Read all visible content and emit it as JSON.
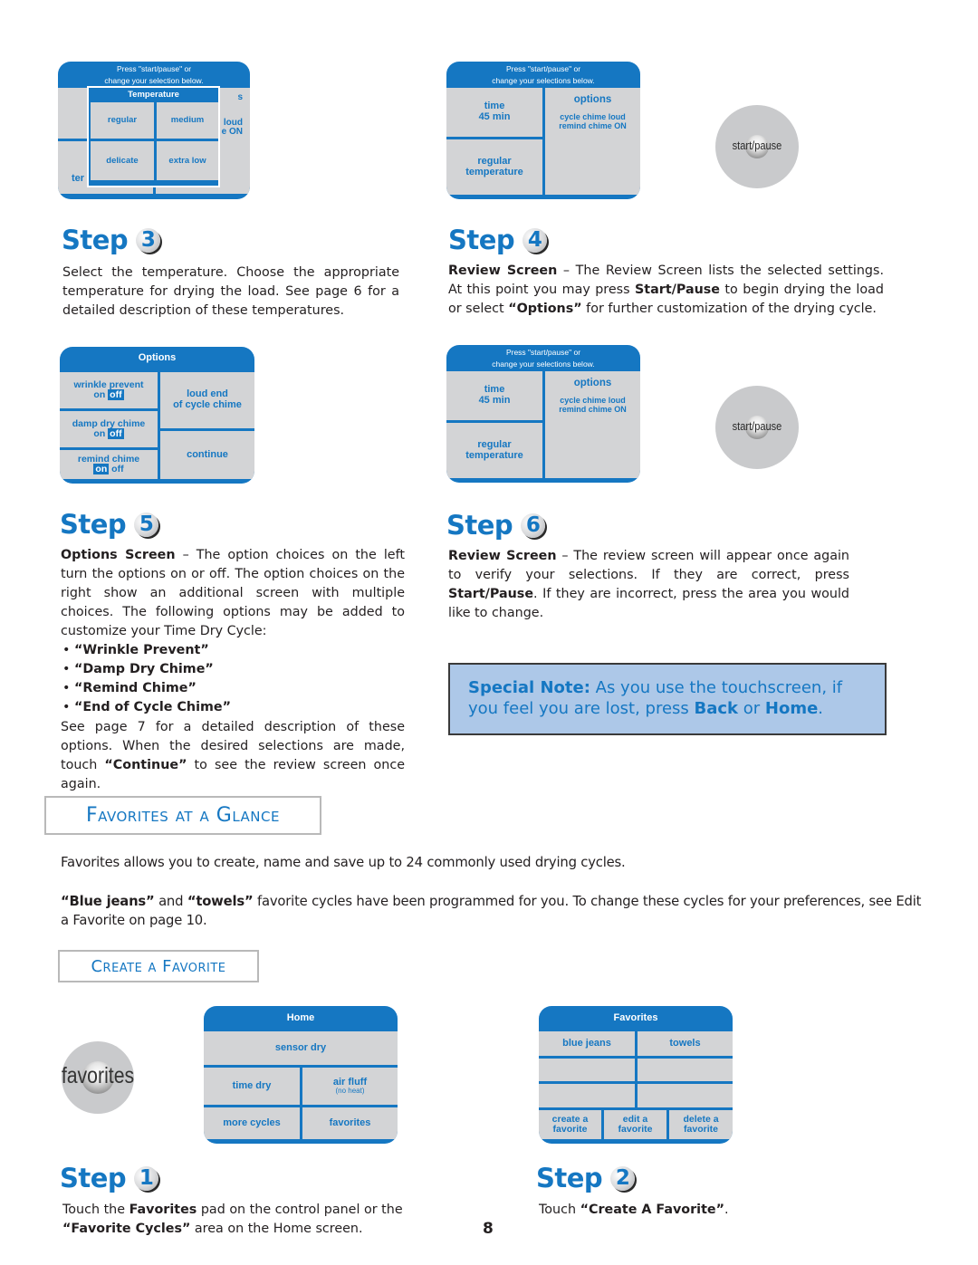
{
  "screens": {
    "temperature_overlay": {
      "prompt_line1": "Press \"start/pause\" or",
      "prompt_line2": "change your selection below.",
      "title": "Temperature",
      "options": [
        "regular",
        "medium",
        "delicate",
        "extra low"
      ],
      "peek_right_1": "s",
      "peek_right_2": "loud",
      "peek_right_3": "e ON",
      "peek_left": "ter"
    },
    "review": {
      "prompt_line1": "Press \"start/pause\" or",
      "prompt_line2": "change your selections below.",
      "time_label": "time",
      "time_value": "45 min",
      "temp_line1": "regular",
      "temp_line2": "temperature",
      "options_label": "options",
      "options_line1": "cycle chime loud",
      "options_line2": "remind chime ON"
    },
    "options": {
      "title": "Options",
      "wrinkle_label": "wrinkle prevent",
      "damp_label": "damp dry chime",
      "remind_label": "remind chime",
      "on": "on",
      "off": "off",
      "wrinkle_selected": "off",
      "damp_selected": "off",
      "remind_selected": "on",
      "loud_end_line1": "loud end",
      "loud_end_line2": "of cycle chime",
      "continue": "continue"
    },
    "home": {
      "title": "Home",
      "sensor_dry": "sensor dry",
      "time_dry": "time dry",
      "air_fluff": "air fluff",
      "air_fluff_note": "(no heat)",
      "more_cycles": "more cycles",
      "favorites": "favorites"
    },
    "favorites": {
      "title": "Favorites",
      "items": [
        "blue jeans",
        "towels",
        "",
        "",
        "",
        ""
      ],
      "create_line1": "create a",
      "create_line2": "favorite",
      "edit_line1": "edit a",
      "edit_line2": "favorite",
      "delete_line1": "delete a",
      "delete_line2": "favorite"
    }
  },
  "pads": {
    "start_pause": "start/pause",
    "favorites": "favorites"
  },
  "steps": {
    "step3": {
      "word": "Step",
      "num": "3",
      "text": "Select the temperature.  Choose the appropriate temperature for drying the load.  See page 6 for a detailed description of these temperatures."
    },
    "step4": {
      "word": "Step",
      "num": "4",
      "lead": "Review Screen",
      "t1": " – The Review Screen lists the selected settings. At this point you may press ",
      "b1": "Start/Pause",
      "t2": " to begin drying the load or select ",
      "b2": "“Options”",
      "t3": " for further customization of the drying cycle."
    },
    "step5": {
      "word": "Step",
      "num": "5",
      "lead": "Options Screen",
      "t1": " – The option choices on the left turn the options on or off. The option choices on the right show an additional screen with multiple choices. The following options may be added to customize your Time Dry Cycle:",
      "bullets": [
        "“Wrinkle Prevent”",
        "“Damp Dry Chime”",
        "“Remind Chime”",
        "“End of Cycle Chime”"
      ],
      "after1": "See page 7 for a detailed description of these options. When the desired selections are made, touch ",
      "after_bold": "“Continue”",
      "after2": " to see the review screen once again."
    },
    "step6": {
      "word": "Step",
      "num": "6",
      "lead": "Review Screen",
      "t1": " – The review screen will appear once again to verify your selections.  If they are correct, press ",
      "b1": "Start/Pause",
      "t2": ".  If they are incorrect, press the area you would like to change."
    },
    "step1": {
      "word": "Step",
      "num": "1",
      "t1": "Touch the ",
      "b1": "Favorites",
      "t2": " pad on the control panel or the ",
      "b2": "“Favorite Cycles”",
      "t3": " area on the Home screen."
    },
    "step2": {
      "word": "Step",
      "num": "2",
      "t1": "Touch ",
      "b1": "“Create A Favorite”",
      "t2": "."
    }
  },
  "special_note": {
    "lead": "Special Note:",
    "t1": "  As you use the touchscreen, if you feel you are lost, press ",
    "b1": "Back",
    "t2": " or ",
    "b2": "Home",
    "t3": "."
  },
  "sections": {
    "favorites_at_a_glance": "Favorites at a Glance",
    "create_a_favorite": "Create a Favorite"
  },
  "favorites_intro": {
    "p1": "Favorites allows you to create, name and save up to 24 commonly used drying cycles.",
    "p2_b1": "“Blue jeans”",
    "p2_t1": " and ",
    "p2_b2": "“towels”",
    "p2_t2": " favorite cycles have been programmed for you.  To change these cycles for your preferences, see Edit a Favorite on page 10."
  },
  "page_number": "8"
}
